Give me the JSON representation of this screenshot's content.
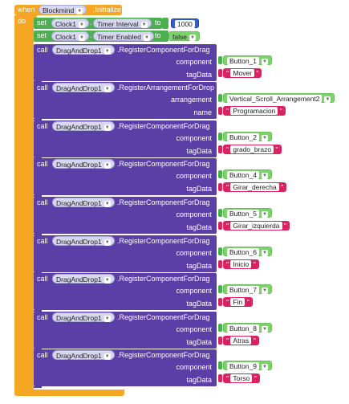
{
  "event": {
    "when_label": "when",
    "component": "Blockmind",
    "event_name": ".Initialize",
    "do_label": "do"
  },
  "set_blocks": [
    {
      "set_label": "set",
      "component": "Clock1",
      "property": "Timer Interval",
      "to_label": "to",
      "value": "1000"
    },
    {
      "set_label": "set",
      "component": "Clock1",
      "property": "Timer Enabled",
      "to_label": "to",
      "value": "false"
    }
  ],
  "call_blocks": [
    {
      "call_label": "call",
      "component": "DragAndDrop1",
      "method": ".RegisterComponentForDrag",
      "param1_label": "component",
      "param1_value": "Button_1",
      "param2_label": "tagData",
      "param2_value": "Mover"
    },
    {
      "call_label": "call",
      "component": "DragAndDrop1",
      "method": ".RegisterArrangementForDrop",
      "param1_label": "arrangement",
      "param1_value": "Vertical_Scroll_Arrangement2",
      "param2_label": "name",
      "param2_value": "Programacion"
    },
    {
      "call_label": "call",
      "component": "DragAndDrop1",
      "method": ".RegisterComponentForDrag",
      "param1_label": "component",
      "param1_value": "Button_2",
      "param2_label": "tagData",
      "param2_value": "grado_brazo"
    },
    {
      "call_label": "call",
      "component": "DragAndDrop1",
      "method": ".RegisterComponentForDrag",
      "param1_label": "component",
      "param1_value": "Button_4",
      "param2_label": "tagData",
      "param2_value": "Girar_derecha"
    },
    {
      "call_label": "call",
      "component": "DragAndDrop1",
      "method": ".RegisterComponentForDrag",
      "param1_label": "component",
      "param1_value": "Button_5",
      "param2_label": "tagData",
      "param2_value": "Girar_izquierda"
    },
    {
      "call_label": "call",
      "component": "DragAndDrop1",
      "method": ".RegisterComponentForDrag",
      "param1_label": "component",
      "param1_value": "Button_6",
      "param2_label": "tagData",
      "param2_value": "Inicio"
    },
    {
      "call_label": "call",
      "component": "DragAndDrop1",
      "method": ".RegisterComponentForDrag",
      "param1_label": "component",
      "param1_value": "Button_7",
      "param2_label": "tagData",
      "param2_value": "Fin"
    },
    {
      "call_label": "call",
      "component": "DragAndDrop1",
      "method": ".RegisterComponentForDrag",
      "param1_label": "component",
      "param1_value": "Button_8",
      "param2_label": "tagData",
      "param2_value": "Atras"
    },
    {
      "call_label": "call",
      "component": "DragAndDrop1",
      "method": ".RegisterComponentForDrag",
      "param1_label": "component",
      "param1_value": "Button_9",
      "param2_label": "tagData",
      "param2_value": "Torso"
    }
  ],
  "colors": {
    "event": "#f5a623",
    "set": "#4caf50",
    "call": "#5b3fa6",
    "text_literal": "#d9225f",
    "number_literal": "#2f5fd6"
  },
  "quote_char": "\""
}
